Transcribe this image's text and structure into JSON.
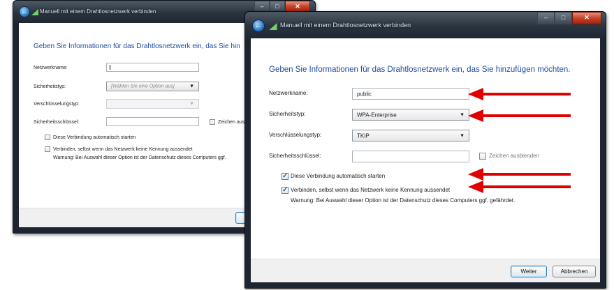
{
  "window_back": {
    "title": "Manuell mit einem Drahtlosnetzwerk verbinden",
    "heading": "Geben Sie Informationen für das Drahtlosnetzwerk ein, das Sie hin",
    "network_name_label": "Netzwerkname:",
    "network_name_value": "",
    "security_type_label": "Sicherheitstyp:",
    "security_type_value": "[Wählen Sie eine Option aus]",
    "encryption_type_label": "Verschlüsselungstyp:",
    "encryption_type_value": "",
    "security_key_label": "Sicherheitsschlüssel:",
    "hide_chars_label": "Zeichen aus",
    "auto_start_label": "Diese Verbindung automatisch starten",
    "auto_start_checked": false,
    "hidden_connect_label": "Verbinden, selbst wenn das Netzwerk keine Kennung aussendet",
    "hidden_connect_checked": false,
    "warning_text": "Warnung: Bei Auswahl dieser Option ist der Datenschutz dieses Computers ggf.",
    "next_button_label": "W"
  },
  "window_front": {
    "title": "Manuell mit einem Drahtlosnetzwerk verbinden",
    "heading": "Geben Sie Informationen für das Drahtlosnetzwerk ein, das Sie hinzufügen möchten.",
    "network_name_label": "Netzwerkname:",
    "network_name_value": "public",
    "security_type_label": "Sicherheitstyp:",
    "security_type_value": "WPA-Enterprise",
    "encryption_type_label": "Verschlüsselungstyp:",
    "encryption_type_value": "TKIP",
    "security_key_label": "Sicherheitsschlüssel:",
    "hide_chars_label": "Zeichen ausblenden",
    "hide_chars_checked": false,
    "auto_start_label": "Diese Verbindung automatisch starten",
    "auto_start_checked": true,
    "hidden_connect_label": "Verbinden, selbst wenn das Netzwerk keine Kennung aussendet",
    "hidden_connect_checked": true,
    "warning_text": "Warnung: Bei Auswahl dieser Option ist der Datenschutz dieses Computers ggf. gefährdet.",
    "next_button_label": "Weiter",
    "cancel_button_label": "Abbrechen"
  },
  "colors": {
    "heading": "#1f4ea1",
    "annotation_arrow": "#e00000",
    "titlebar": "#2a343f",
    "close_button": "#c8432b"
  },
  "annotations": {
    "arrow_count": 5,
    "icon": "arrow-left-icon"
  }
}
